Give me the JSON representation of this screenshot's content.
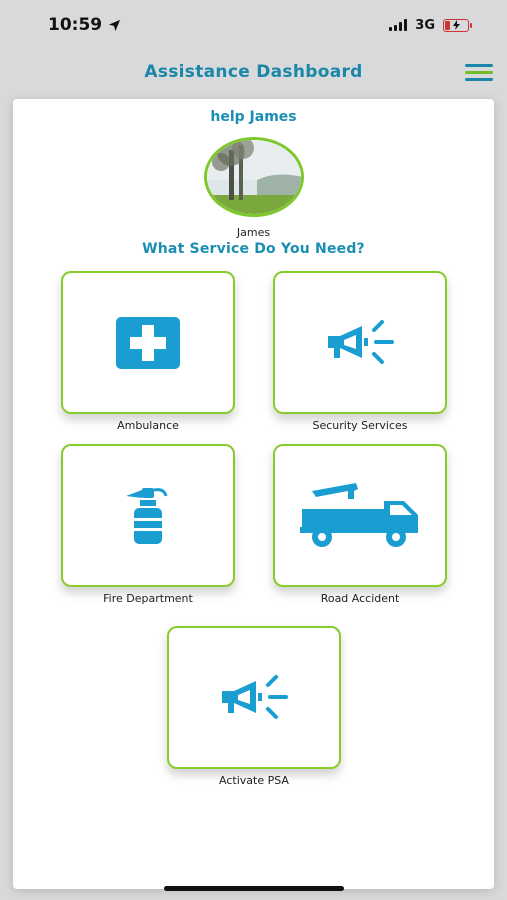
{
  "status_bar": {
    "time": "10:59",
    "network": "3G"
  },
  "header": {
    "title": "Assistance Dashboard"
  },
  "modal": {
    "help_title": "help James",
    "user_name": "James",
    "question": "What Service Do You Need?"
  },
  "services": [
    {
      "label": "Ambulance",
      "icon": "ambulance-cross-icon"
    },
    {
      "label": "Security Services",
      "icon": "megaphone-icon"
    },
    {
      "label": "Fire Department",
      "icon": "fire-extinguisher-icon"
    },
    {
      "label": "Road Accident",
      "icon": "tow-truck-icon"
    },
    {
      "label": "Activate PSA",
      "icon": "megaphone-icon"
    }
  ],
  "colors": {
    "accent_blue": "#1a8fb3",
    "icon_blue": "#1a9ed1",
    "card_border_green": "#86cc2d",
    "menu_blue": "#1a8fb3",
    "menu_green": "#7dc82a"
  }
}
